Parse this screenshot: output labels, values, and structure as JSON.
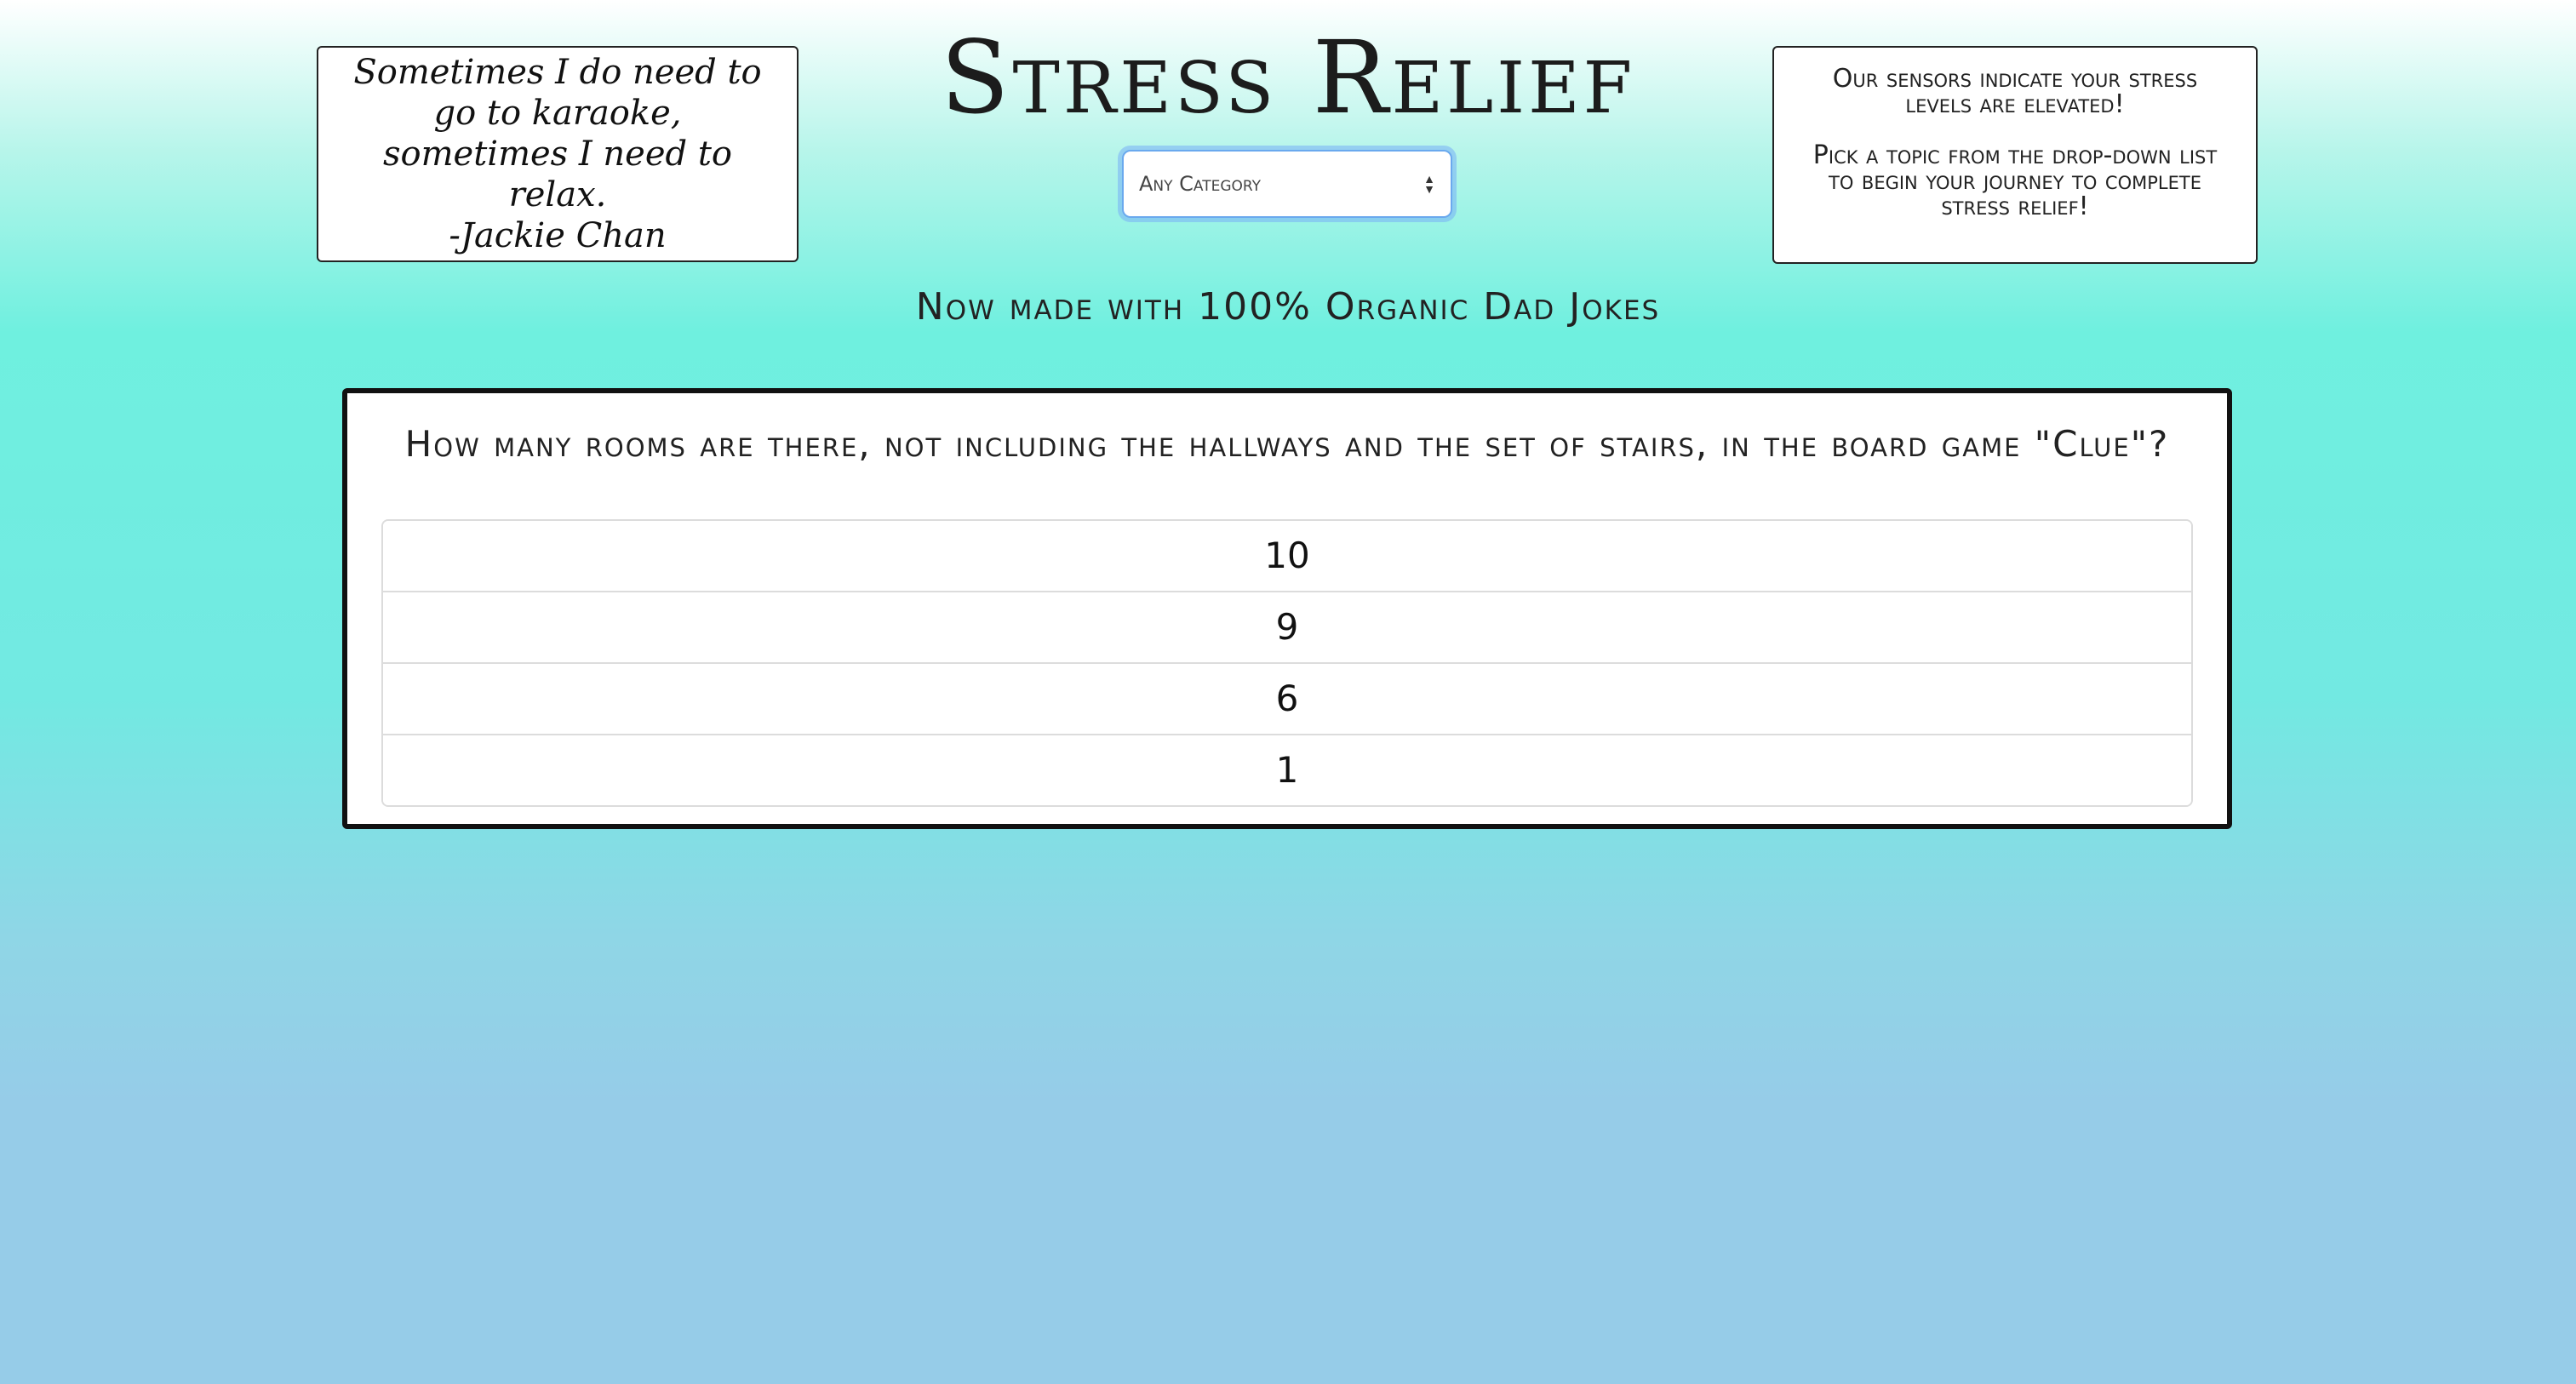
{
  "header": {
    "title": "Stress Relief",
    "tagline": "Now made with 100% Organic Dad Jokes"
  },
  "quote": {
    "text": "Sometimes I do need to go to karaoke, sometimes I need to relax.",
    "author": "-Jackie Chan"
  },
  "info": {
    "line1": "Our sensors indicate your stress levels are elevated!",
    "line2": "Pick a topic from the drop-down list to begin your journey to complete stress relief!"
  },
  "category_select": {
    "selected": "Any Category",
    "icon": "updown-arrows-icon"
  },
  "question": {
    "text": "How many rooms are there, not including the hallways and the set of stairs, in the board game \"Clue\"?",
    "answers": [
      "10",
      "9",
      "6",
      "1"
    ]
  },
  "colors": {
    "card_border": "#111111",
    "select_focus": "#6aa9ee",
    "bg_top": "#ffffff",
    "bg_mid": "#6ff0df",
    "bg_bottom": "#96cce8"
  }
}
